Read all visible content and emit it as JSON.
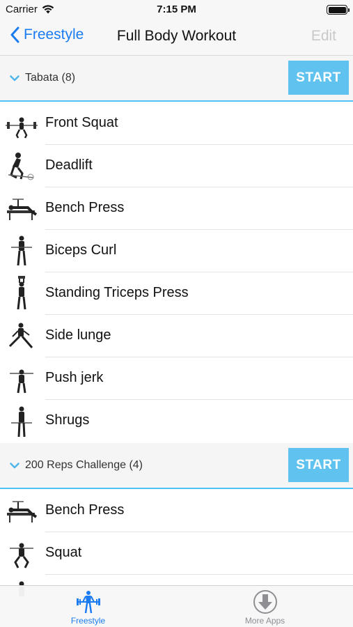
{
  "status_bar": {
    "carrier": "Carrier",
    "time": "7:15 PM"
  },
  "nav": {
    "back_label": "Freestyle",
    "title": "Full Body Workout",
    "edit_label": "Edit"
  },
  "sections": [
    {
      "title": "Tabata (8)",
      "start_label": "START",
      "exercises": [
        {
          "name": "Front Squat"
        },
        {
          "name": "Deadlift"
        },
        {
          "name": "Bench Press"
        },
        {
          "name": "Biceps Curl"
        },
        {
          "name": "Standing Triceps Press"
        },
        {
          "name": "Side lunge"
        },
        {
          "name": "Push jerk"
        },
        {
          "name": "Shrugs"
        }
      ]
    },
    {
      "title": "200 Reps Challenge (4)",
      "start_label": "START",
      "exercises": [
        {
          "name": "Bench Press"
        },
        {
          "name": "Squat"
        }
      ]
    }
  ],
  "tab_bar": {
    "tabs": [
      {
        "label": "Freestyle",
        "icon": "weightlifter-icon",
        "active": true
      },
      {
        "label": "More Apps",
        "icon": "download-circle-icon",
        "active": false
      }
    ]
  },
  "colors": {
    "accent": "#1a7cf0",
    "start_button": "#5fc2ef",
    "section_rule": "#4fc1f2",
    "tab_active": "#1a7cf0",
    "tab_inactive": "#8e8e93"
  }
}
